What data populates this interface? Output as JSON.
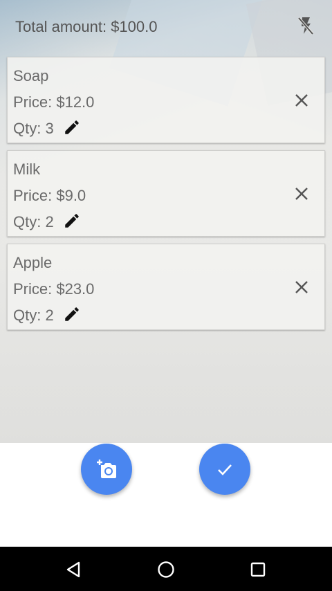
{
  "header": {
    "total_label": "Total amount: $100.0",
    "flash_icon": "flash-off-icon"
  },
  "items": [
    {
      "name": "Soap",
      "price": "Price: $12.0",
      "qty": "Qty: 3"
    },
    {
      "name": "Milk",
      "price": "Price: $9.0",
      "qty": "Qty: 2"
    },
    {
      "name": "Apple",
      "price": "Price: $23.0",
      "qty": "Qty: 2"
    }
  ],
  "icons": {
    "edit": "pencil-icon",
    "remove": "close-icon",
    "add_photo": "add-a-photo-icon",
    "confirm": "check-icon"
  },
  "colors": {
    "fab": "#4a86f0",
    "text": "#6a6a6a",
    "navbar": "#000000"
  },
  "navbar": {
    "back": "back-icon",
    "home": "home-icon",
    "recent": "recent-apps-icon"
  }
}
